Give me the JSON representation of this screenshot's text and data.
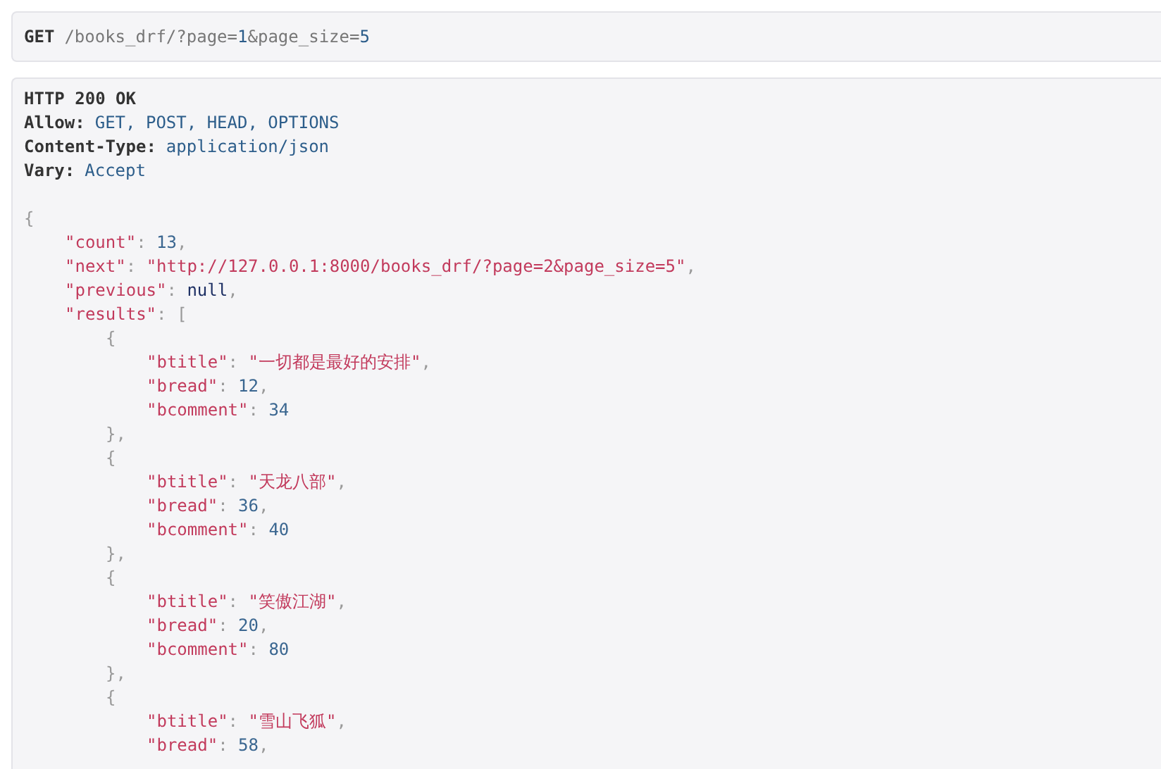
{
  "request": {
    "method": "GET",
    "url_parts": [
      {
        "kind": "plain",
        "text": "/books_drf/?page="
      },
      {
        "kind": "value",
        "text": "1"
      },
      {
        "kind": "plain",
        "text": "&page_size="
      },
      {
        "kind": "value",
        "text": "5"
      }
    ]
  },
  "response": {
    "status": "HTTP 200 OK",
    "headers": [
      {
        "name": "Allow:",
        "value": "GET, POST, HEAD, OPTIONS"
      },
      {
        "name": "Content-Type:",
        "value": "application/json"
      },
      {
        "name": "Vary:",
        "value": "Accept"
      }
    ],
    "body": {
      "open": [
        {
          "kind": "punct",
          "text": "{"
        }
      ],
      "children": [
        {
          "tokens": [
            {
              "kind": "key",
              "text": "\"count\""
            },
            {
              "kind": "punct",
              "text": ": "
            },
            {
              "kind": "number",
              "text": "13"
            },
            {
              "kind": "punct",
              "text": ","
            }
          ]
        },
        {
          "tokens": [
            {
              "kind": "key",
              "text": "\"next\""
            },
            {
              "kind": "punct",
              "text": ": "
            },
            {
              "kind": "string",
              "text": "\"http://127.0.0.1:8000/books_drf/?page=2&page_size=5\""
            },
            {
              "kind": "punct",
              "text": ","
            }
          ]
        },
        {
          "tokens": [
            {
              "kind": "key",
              "text": "\"previous\""
            },
            {
              "kind": "punct",
              "text": ": "
            },
            {
              "kind": "null",
              "text": "null"
            },
            {
              "kind": "punct",
              "text": ","
            }
          ]
        },
        {
          "open": [
            {
              "kind": "key",
              "text": "\"results\""
            },
            {
              "kind": "punct",
              "text": ": ["
            }
          ],
          "children": [
            {
              "open": [
                {
                  "kind": "punct",
                  "text": "{"
                }
              ],
              "children": [
                {
                  "tokens": [
                    {
                      "kind": "key",
                      "text": "\"btitle\""
                    },
                    {
                      "kind": "punct",
                      "text": ": "
                    },
                    {
                      "kind": "string",
                      "text": "\"一切都是最好的安排\""
                    },
                    {
                      "kind": "punct",
                      "text": ","
                    }
                  ]
                },
                {
                  "tokens": [
                    {
                      "kind": "key",
                      "text": "\"bread\""
                    },
                    {
                      "kind": "punct",
                      "text": ": "
                    },
                    {
                      "kind": "number",
                      "text": "12"
                    },
                    {
                      "kind": "punct",
                      "text": ","
                    }
                  ]
                },
                {
                  "tokens": [
                    {
                      "kind": "key",
                      "text": "\"bcomment\""
                    },
                    {
                      "kind": "punct",
                      "text": ": "
                    },
                    {
                      "kind": "number",
                      "text": "34"
                    }
                  ]
                }
              ],
              "close": [
                {
                  "kind": "punct",
                  "text": "},"
                }
              ]
            },
            {
              "open": [
                {
                  "kind": "punct",
                  "text": "{"
                }
              ],
              "children": [
                {
                  "tokens": [
                    {
                      "kind": "key",
                      "text": "\"btitle\""
                    },
                    {
                      "kind": "punct",
                      "text": ": "
                    },
                    {
                      "kind": "string",
                      "text": "\"天龙八部\""
                    },
                    {
                      "kind": "punct",
                      "text": ","
                    }
                  ]
                },
                {
                  "tokens": [
                    {
                      "kind": "key",
                      "text": "\"bread\""
                    },
                    {
                      "kind": "punct",
                      "text": ": "
                    },
                    {
                      "kind": "number",
                      "text": "36"
                    },
                    {
                      "kind": "punct",
                      "text": ","
                    }
                  ]
                },
                {
                  "tokens": [
                    {
                      "kind": "key",
                      "text": "\"bcomment\""
                    },
                    {
                      "kind": "punct",
                      "text": ": "
                    },
                    {
                      "kind": "number",
                      "text": "40"
                    }
                  ]
                }
              ],
              "close": [
                {
                  "kind": "punct",
                  "text": "},"
                }
              ]
            },
            {
              "open": [
                {
                  "kind": "punct",
                  "text": "{"
                }
              ],
              "children": [
                {
                  "tokens": [
                    {
                      "kind": "key",
                      "text": "\"btitle\""
                    },
                    {
                      "kind": "punct",
                      "text": ": "
                    },
                    {
                      "kind": "string",
                      "text": "\"笑傲江湖\""
                    },
                    {
                      "kind": "punct",
                      "text": ","
                    }
                  ]
                },
                {
                  "tokens": [
                    {
                      "kind": "key",
                      "text": "\"bread\""
                    },
                    {
                      "kind": "punct",
                      "text": ": "
                    },
                    {
                      "kind": "number",
                      "text": "20"
                    },
                    {
                      "kind": "punct",
                      "text": ","
                    }
                  ]
                },
                {
                  "tokens": [
                    {
                      "kind": "key",
                      "text": "\"bcomment\""
                    },
                    {
                      "kind": "punct",
                      "text": ": "
                    },
                    {
                      "kind": "number",
                      "text": "80"
                    }
                  ]
                }
              ],
              "close": [
                {
                  "kind": "punct",
                  "text": "},"
                }
              ]
            },
            {
              "open": [
                {
                  "kind": "punct",
                  "text": "{"
                }
              ],
              "children": [
                {
                  "tokens": [
                    {
                      "kind": "key",
                      "text": "\"btitle\""
                    },
                    {
                      "kind": "punct",
                      "text": ": "
                    },
                    {
                      "kind": "string",
                      "text": "\"雪山飞狐\""
                    },
                    {
                      "kind": "punct",
                      "text": ","
                    }
                  ]
                },
                {
                  "tokens": [
                    {
                      "kind": "key",
                      "text": "\"bread\""
                    },
                    {
                      "kind": "punct",
                      "text": ": "
                    },
                    {
                      "kind": "number",
                      "text": "58"
                    },
                    {
                      "kind": "punct",
                      "text": ","
                    }
                  ]
                }
              ]
            }
          ]
        }
      ]
    }
  }
}
